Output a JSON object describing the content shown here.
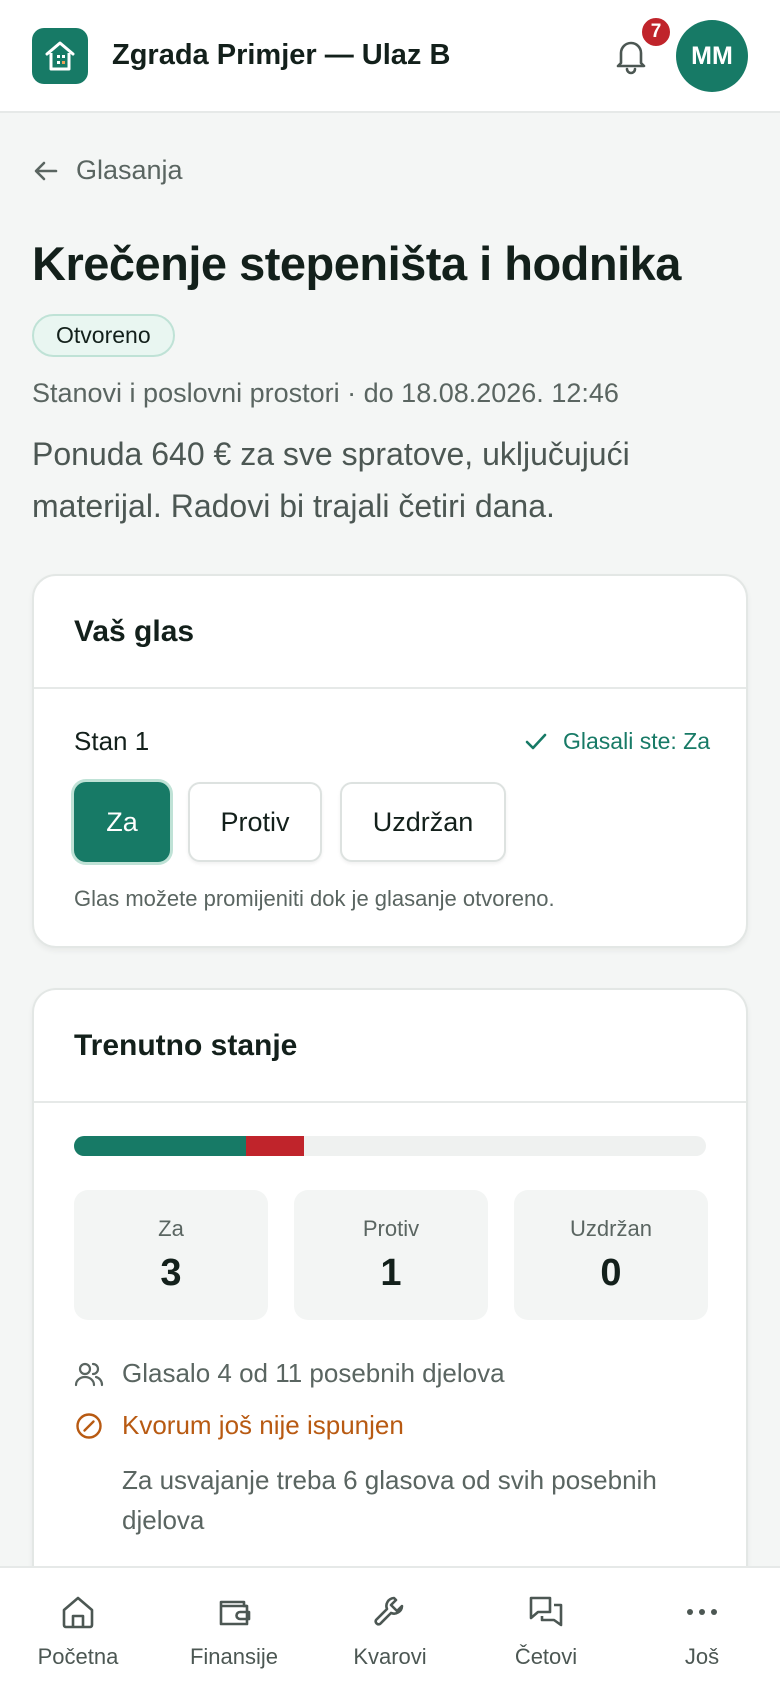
{
  "header": {
    "app_title": "Zgrada Primjer — Ulaz B",
    "notification_count": "7",
    "avatar_initials": "MM",
    "brand_color": "#177a66"
  },
  "back": {
    "label": "Glasanja"
  },
  "vote": {
    "title": "Krečenje stepeništa i hodnika",
    "status": "Otvoreno",
    "meta": "Stanovi i poslovni prostori · do 18.08.2026. 12:46",
    "description": "Ponuda 640 € za sve spratove, uključujući materijal. Radovi bi trajali četiri dana."
  },
  "your_vote": {
    "heading": "Vaš glas",
    "unit_label": "Stan 1",
    "voted_label": "Glasali ste: Za",
    "options": [
      "Za",
      "Protiv",
      "Uzdržan"
    ],
    "selected": "Za",
    "hint": "Glas možete promijeniti dok je glasanje otvoreno."
  },
  "results": {
    "heading": "Trenutno stanje",
    "total_units": 11,
    "counts": [
      {
        "label": "Za",
        "value": "3",
        "color": "#177a66"
      },
      {
        "label": "Protiv",
        "value": "1",
        "color": "#c0242b"
      },
      {
        "label": "Uzdržan",
        "value": "0",
        "color": "#9aa3a0"
      }
    ],
    "voted_summary": "Glasalo 4 od 11 posebnih djelova",
    "quorum_status": "Kvorum još nije ispunjen",
    "quorum_note": "Za usvajanje treba 6 glasova od svih posebnih djelova"
  },
  "bottom_nav": {
    "items": [
      {
        "label": "Početna",
        "icon": "home-icon"
      },
      {
        "label": "Finansije",
        "icon": "wallet-icon"
      },
      {
        "label": "Kvarovi",
        "icon": "wrench-icon"
      },
      {
        "label": "Četovi",
        "icon": "chat-icon"
      },
      {
        "label": "Još",
        "icon": "more-icon"
      }
    ]
  }
}
